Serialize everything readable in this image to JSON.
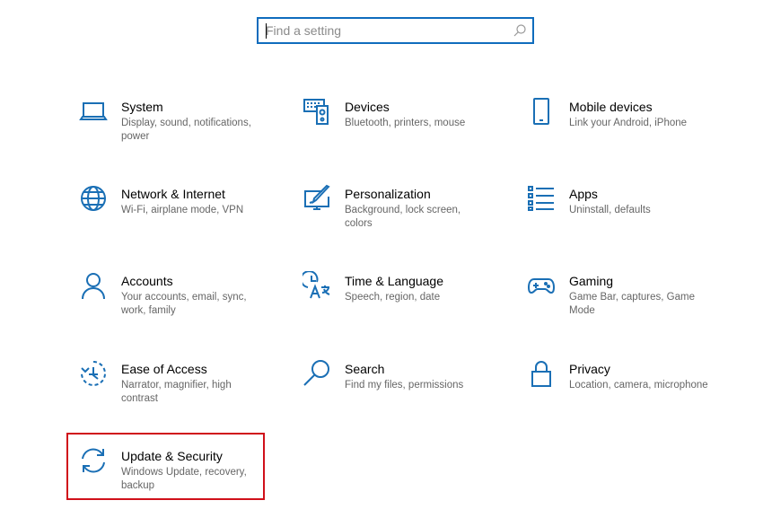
{
  "search": {
    "placeholder": "Find a setting",
    "value": ""
  },
  "accent_color": "#1a6fb5",
  "highlight_color": "#d0101a",
  "items": [
    {
      "title": "System",
      "desc": "Display, sound, notifications, power",
      "icon": "laptop-icon"
    },
    {
      "title": "Devices",
      "desc": "Bluetooth, printers, mouse",
      "icon": "keyboard-speaker-icon"
    },
    {
      "title": "Mobile devices",
      "desc": "Link your Android, iPhone",
      "icon": "phone-icon"
    },
    {
      "title": "Network & Internet",
      "desc": "Wi-Fi, airplane mode, VPN",
      "icon": "globe-icon"
    },
    {
      "title": "Personalization",
      "desc": "Background, lock screen, colors",
      "icon": "paintbrush-monitor-icon"
    },
    {
      "title": "Apps",
      "desc": "Uninstall, defaults",
      "icon": "apps-list-icon"
    },
    {
      "title": "Accounts",
      "desc": "Your accounts, email, sync, work, family",
      "icon": "person-icon"
    },
    {
      "title": "Time & Language",
      "desc": "Speech, region, date",
      "icon": "clock-language-icon"
    },
    {
      "title": "Gaming",
      "desc": "Game Bar, captures, Game Mode",
      "icon": "gamepad-icon"
    },
    {
      "title": "Ease of Access",
      "desc": "Narrator, magnifier, high contrast",
      "icon": "ease-of-access-icon"
    },
    {
      "title": "Search",
      "desc": "Find my files, permissions",
      "icon": "magnifier-icon"
    },
    {
      "title": "Privacy",
      "desc": "Location, camera, microphone",
      "icon": "lock-icon"
    },
    {
      "title": "Update & Security",
      "desc": "Windows Update, recovery, backup",
      "icon": "sync-arrows-icon"
    }
  ]
}
